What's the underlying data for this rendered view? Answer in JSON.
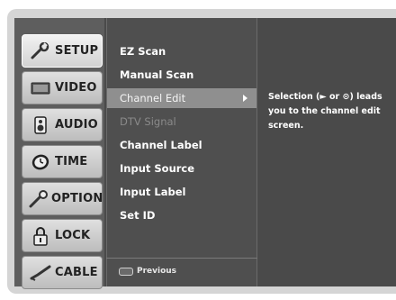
{
  "sidebar": {
    "items": [
      {
        "label": "SETUP",
        "icon": "wrench-icon",
        "active": true
      },
      {
        "label": "VIDEO",
        "icon": "tv-icon",
        "active": false
      },
      {
        "label": "AUDIO",
        "icon": "speaker-icon",
        "active": false
      },
      {
        "label": "TIME",
        "icon": "clock-icon",
        "active": false
      },
      {
        "label": "OPTION",
        "icon": "option-icon",
        "active": false
      },
      {
        "label": "LOCK",
        "icon": "padlock-icon",
        "active": false
      },
      {
        "label": "CABLE",
        "icon": "cable-icon",
        "active": false
      }
    ]
  },
  "submenu": {
    "items": [
      {
        "label": "EZ Scan",
        "state": "normal"
      },
      {
        "label": "Manual Scan",
        "state": "normal"
      },
      {
        "label": "Channel Edit",
        "state": "selected"
      },
      {
        "label": "DTV Signal",
        "state": "disabled"
      },
      {
        "label": "Channel Label",
        "state": "normal"
      },
      {
        "label": "Input Source",
        "state": "normal"
      },
      {
        "label": "Input Label",
        "state": "normal"
      },
      {
        "label": "Set ID",
        "state": "normal"
      }
    ],
    "footer_label": "Previous",
    "footer_key": "MENU"
  },
  "help": {
    "text": "Selection (► or ⊙) leads you to the channel edit screen."
  },
  "colors": {
    "panel": "#4a4a4a",
    "sidebar": "#5e5e5e",
    "selected_row": "#8f8f8f",
    "disabled_text": "#8a8a8a",
    "frame": "#d5d5d5"
  }
}
